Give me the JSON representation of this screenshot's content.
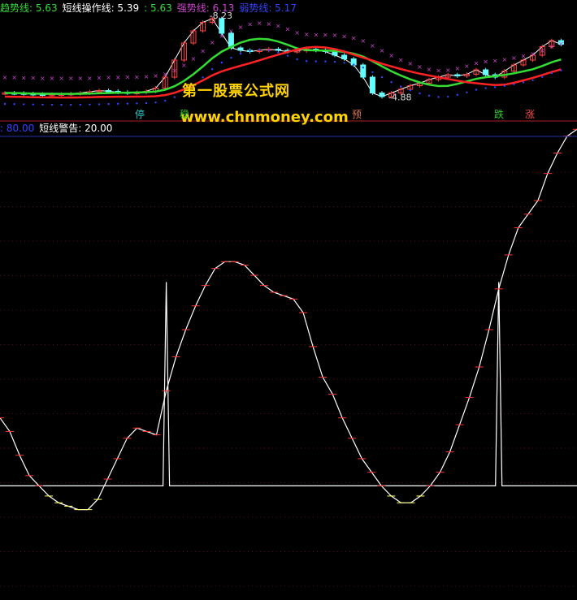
{
  "legend_top": [
    {
      "label": "趋势线",
      "value": "5.63",
      "color": "#33dd33"
    },
    {
      "label": "短线操作线",
      "value": "5.39",
      "color": "#ffffff"
    },
    {
      "label": "",
      "value": "5.63",
      "color": "#33dd33"
    },
    {
      "label": "强势线",
      "value": "6.13",
      "color": "#cc44cc"
    },
    {
      "label": "弱势线",
      "value": "5.17",
      "color": "#3344ff"
    }
  ],
  "legend_bottom": [
    {
      "label": "",
      "value": "80.00",
      "color": "#3344ff"
    },
    {
      "label": "短线警告",
      "value": "20.00",
      "color": "#ffffff"
    }
  ],
  "watermark": {
    "title": "第一股票公式网",
    "url": "www.chnmoney.com"
  },
  "signals": [
    {
      "text": "停",
      "color": "#33cccc"
    },
    {
      "text": "稳",
      "color": "#33cc33"
    },
    {
      "text": "预",
      "color": "#dd7744"
    },
    {
      "text": "跌",
      "color": "#33cc33"
    },
    {
      "text": "涨",
      "color": "#ff4444"
    }
  ],
  "chart_data": [
    {
      "type": "line",
      "panel": "price",
      "annotations": [
        {
          "text": "8.23",
          "value": 8.23
        },
        {
          "text": "4.88",
          "value": 4.88
        }
      ],
      "series": [
        {
          "name": "趋势线",
          "color": "#33dd33"
        },
        {
          "name": "强势线",
          "color": "#cc44cc"
        },
        {
          "name": "弱势线",
          "color": "#3344ff"
        }
      ]
    },
    {
      "type": "line",
      "panel": "indicator",
      "ylim": [
        0,
        100
      ],
      "levels": [
        80,
        20
      ],
      "series": [
        {
          "name": "短线警告",
          "color": "#ffffff",
          "values": [
            40,
            36,
            29,
            23,
            20,
            17,
            15,
            14,
            13,
            13,
            16,
            22,
            28,
            34,
            37,
            36,
            35,
            48,
            58,
            66,
            73,
            79,
            84,
            86,
            86,
            85,
            82,
            79,
            77,
            76,
            75,
            71,
            61,
            52,
            47,
            40,
            34,
            28,
            24,
            20,
            17,
            15,
            15,
            17,
            20,
            24,
            30,
            38,
            46,
            55,
            66,
            78,
            88,
            96,
            100,
            104,
            112,
            118,
            123,
            125
          ]
        },
        {
          "name": "信号",
          "color": "#ffffff",
          "values": [
            20,
            20,
            20,
            20,
            20,
            20,
            20,
            20,
            20,
            20,
            20,
            20,
            20,
            20,
            20,
            20,
            20,
            80,
            20,
            20,
            20,
            20,
            20,
            20,
            20,
            20,
            20,
            20,
            20,
            20,
            20,
            20,
            20,
            20,
            20,
            20,
            20,
            20,
            20,
            20,
            20,
            20,
            20,
            20,
            20,
            20,
            20,
            20,
            20,
            20,
            20,
            80,
            20,
            20,
            20,
            20,
            20,
            20,
            20,
            20
          ]
        }
      ]
    }
  ]
}
